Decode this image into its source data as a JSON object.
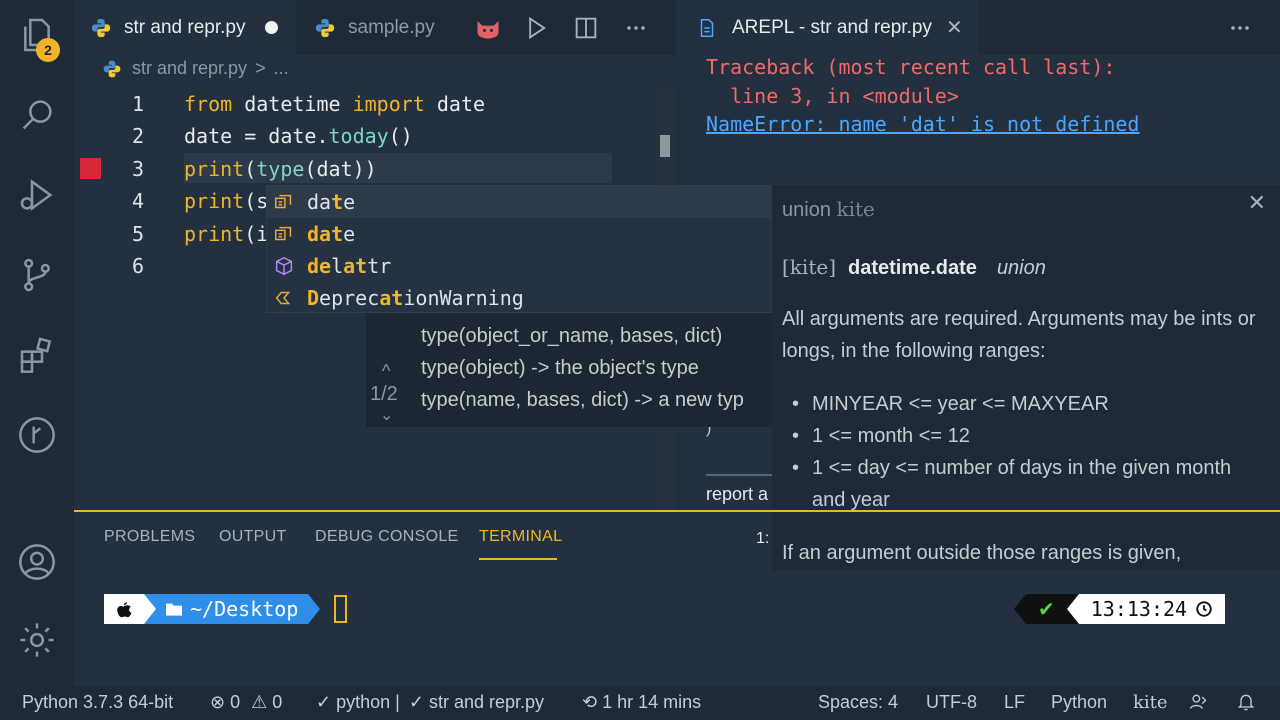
{
  "colors": {
    "accent": "#f0b429",
    "error": "#ee6a6a",
    "link": "#4da6ff",
    "breakpoint": "#d7283a"
  },
  "activity_bar": {
    "explorer_badge": "2"
  },
  "tabs": [
    {
      "label": "str and repr.py",
      "modified": true,
      "icon": "python-icon"
    },
    {
      "label": "sample.py",
      "icon": "python-icon"
    }
  ],
  "breadcrumb": {
    "file": "str and repr.py",
    "separator": ">",
    "rest": "..."
  },
  "editor": {
    "line_numbers": [
      "1",
      "2",
      "3",
      "4",
      "5",
      "6"
    ],
    "lines": {
      "l1": {
        "kw1": "from",
        "mod": " datetime ",
        "kw2": "import",
        "name": " date"
      },
      "l2": {
        "a": "date",
        "b": " = date.",
        "fn": "today",
        "c": "()"
      },
      "l3": {
        "fn1": "print",
        "p1": "(",
        "fn2": "type",
        "p2": "(",
        "arg": "dat",
        "p3": "))"
      },
      "l4": {
        "fn": "print",
        "rest": "(s"
      },
      "l5": {
        "fn": "print",
        "rest": "(i"
      }
    }
  },
  "suggest": [
    {
      "match": "dat",
      "rest": "e",
      "display": [
        "d",
        "a",
        "t",
        "e"
      ],
      "icon": "field-icon"
    },
    {
      "match": "dat",
      "rest": "e",
      "icon": "field-icon"
    },
    {
      "icon": "cube-icon",
      "parts": [
        "de",
        "l",
        "at",
        "tr"
      ]
    },
    {
      "icon": "class-icon",
      "parts": [
        "D",
        "eprec",
        "at",
        "ionWarning"
      ]
    }
  ],
  "signature_help": {
    "count": "1/2",
    "lines": [
      "type(object_or_name, bases, dict)",
      "type(object) -> the object's type",
      "type(name, bases, dict) -> a new typ"
    ]
  },
  "kite": {
    "top": "union",
    "top_brand": "kite",
    "brand": "[kite]",
    "symbol": "datetime.date",
    "kind": "union",
    "para1": "All arguments are required. Arguments may be ints or longs, in the following ranges:",
    "bullets": [
      "MINYEAR <= year <= MAXYEAR",
      "1 <= month <= 12",
      "1 <= day <= number of days in the given month and year"
    ],
    "para2": "If an argument outside those ranges is given,"
  },
  "arepl": {
    "tab_label": "AREPL - str and repr.py",
    "traceback_1": "Traceback (most recent call last):",
    "traceback_2": "  line 3, in <module>",
    "error": "NameError: name 'dat' is not defined",
    "report": "report a",
    "fragment": ")"
  },
  "panel": {
    "tabs": [
      "PROBLEMS",
      "OUTPUT",
      "DEBUG CONSOLE",
      "TERMINAL"
    ],
    "active": "TERMINAL",
    "terminal_selector": "1:"
  },
  "terminal": {
    "dir": "~/Desktop",
    "dir_icon": "folder-icon",
    "check": "✔",
    "time": "13:13:24"
  },
  "statusbar": {
    "python": "Python 3.7.3 64-bit",
    "errors": "0",
    "warnings": "0",
    "python_env": "python |",
    "file": "str and repr.py",
    "time_tracked": "1 hr 14 mins",
    "spaces": "Spaces: 4",
    "encoding": "UTF-8",
    "eol": "LF",
    "language": "Python",
    "kite": "kite"
  }
}
